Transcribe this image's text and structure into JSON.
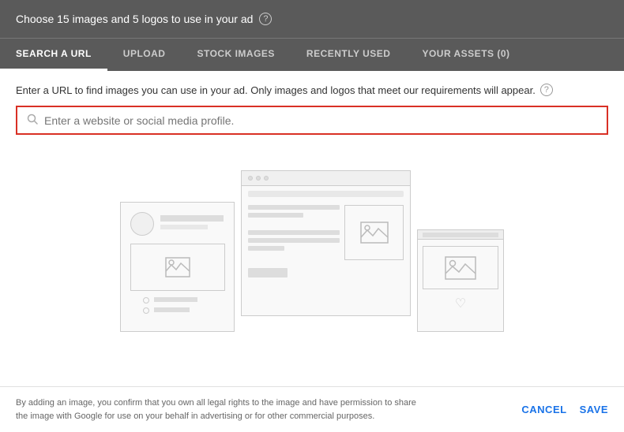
{
  "header": {
    "title": "Choose 15 images and 5 logos to use in your ad",
    "help_icon": "?"
  },
  "tabs": [
    {
      "id": "search-url",
      "label": "SEARCH A URL",
      "active": true
    },
    {
      "id": "upload",
      "label": "UPLOAD",
      "active": false
    },
    {
      "id": "stock-images",
      "label": "STOCK IMAGES",
      "active": false
    },
    {
      "id": "recently-used",
      "label": "RECENTLY USED",
      "active": false
    },
    {
      "id": "your-assets",
      "label": "YOUR ASSETS (0)",
      "active": false
    }
  ],
  "search_url_tab": {
    "description": "Enter a URL to find images you can use in your ad. Only images and logos that meet our requirements will appear.",
    "search_placeholder": "Enter a website or social media profile."
  },
  "footer": {
    "text": "By adding an image, you confirm that you own all legal rights to the image and have permission to share\nthe image with Google for use on your behalf in advertising or for other commercial purposes.",
    "cancel_label": "CANCEL",
    "save_label": "SAVE"
  },
  "colors": {
    "header_bg": "#5a5a5a",
    "tab_active_border": "#ffffff",
    "input_border_error": "#d93025",
    "button_color": "#1a73e8"
  }
}
